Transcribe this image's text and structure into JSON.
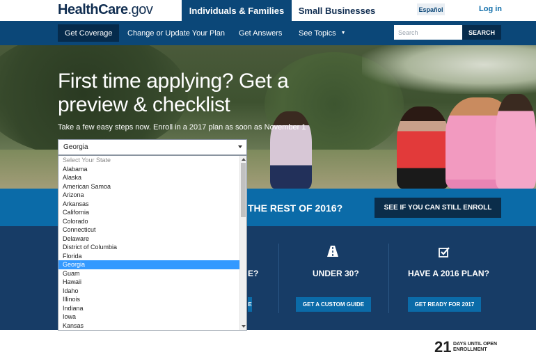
{
  "header": {
    "logo_main": "HealthCare",
    "logo_suffix": ".gov",
    "tab_individuals": "Individuals & Families",
    "tab_business": "Small Businesses",
    "espanol": "Español",
    "login": "Log in"
  },
  "nav": {
    "items": [
      "Get Coverage",
      "Change or Update Your Plan",
      "Get Answers",
      "See Topics"
    ],
    "search_placeholder": "Search",
    "search_button": "SEARCH"
  },
  "hero": {
    "title": "First time applying? Get a preview & checklist",
    "subtitle": "Take a few easy steps now. Enroll in a 2017 plan as soon as November 1",
    "selected_state": "Georgia"
  },
  "dropdown": {
    "placeholder": "Select Your State",
    "options": [
      "Alabama",
      "Alaska",
      "American Samoa",
      "Arizona",
      "Arkansas",
      "California",
      "Colorado",
      "Connecticut",
      "Delaware",
      "District of Columbia",
      "Florida",
      "Georgia",
      "Guam",
      "Hawaii",
      "Idaho",
      "Illinois",
      "Indiana",
      "Iowa",
      "Kansas"
    ],
    "selected": "Georgia"
  },
  "banner": {
    "text": "THE REST OF 2016?",
    "button": "SEE IF YOU CAN STILL ENROLL"
  },
  "cards": [
    {
      "title": "E?",
      "button": "E",
      "icon": "question-icon"
    },
    {
      "title": "UNDER 30?",
      "button": "GET A CUSTOM GUIDE",
      "icon": "road-icon"
    },
    {
      "title": "HAVE A 2016 PLAN?",
      "button": "GET READY FOR 2017",
      "icon": "checkbox-icon"
    }
  ],
  "footer": {
    "countdown_number": "21",
    "countdown_label": "DAYS UNTIL OPEN ENROLLMENT"
  }
}
